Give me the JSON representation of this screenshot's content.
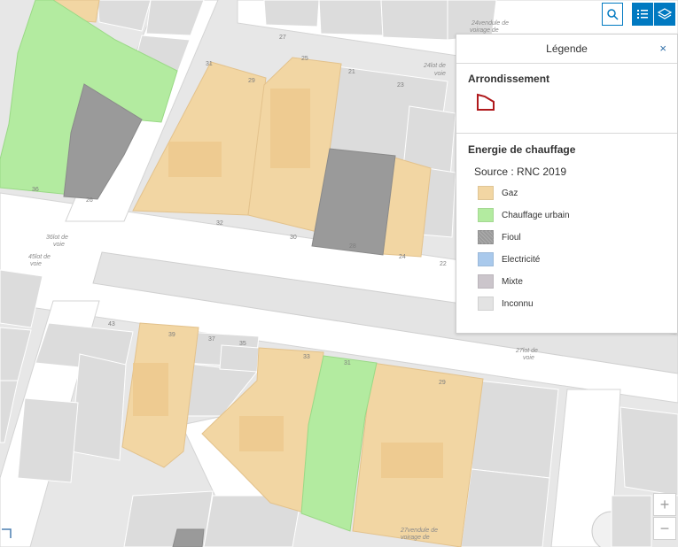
{
  "toolbar": {
    "search_icon": "search-icon",
    "legend_icon": "legend-list-icon",
    "layers_icon": "layers-icon"
  },
  "legend": {
    "title": "Légende",
    "close_label": "×",
    "arrondissement": {
      "title": "Arrondissement",
      "symbol_color": "#b0191c"
    },
    "energie": {
      "title": "Energie de chauffage",
      "source": "Source : RNC 2019",
      "items": [
        {
          "label": "Gaz",
          "color": "#f2d6a3"
        },
        {
          "label": "Chauffage urbain",
          "color": "#b3eba0"
        },
        {
          "label": "Fioul",
          "color": "#9a9a9a"
        },
        {
          "label": "Electricité",
          "color": "#a9c9ec"
        },
        {
          "label": "Mixte",
          "color": "#cbc5cb"
        },
        {
          "label": "Inconnu",
          "color": "#e3e3e3"
        }
      ]
    }
  },
  "zoom": {
    "in_label": "+",
    "out_label": "−"
  },
  "map_labels": {
    "n27": "27",
    "n21": "21",
    "n31": "31",
    "n29a": "29",
    "n25": "25",
    "n23": "23",
    "n22": "22",
    "n32": "32",
    "n30": "30",
    "n28": "28",
    "n24": "24",
    "n26": "26",
    "n36": "36",
    "n43": "43",
    "n39": "39",
    "n37": "37",
    "n35": "35",
    "n33": "33",
    "n31b": "31",
    "n29b": "29",
    "lot36": "36lot de",
    "voie36": "voie",
    "lot45": "45lot de",
    "voie45": "voie",
    "lot24": "24lot de",
    "voie24": "voie",
    "lot27": "27lot de",
    "voie27": "voie",
    "pass24": "24vendule de",
    "pass24b": "voirage de",
    "pass27": "27vendule de",
    "pass27b": "voirage de"
  }
}
